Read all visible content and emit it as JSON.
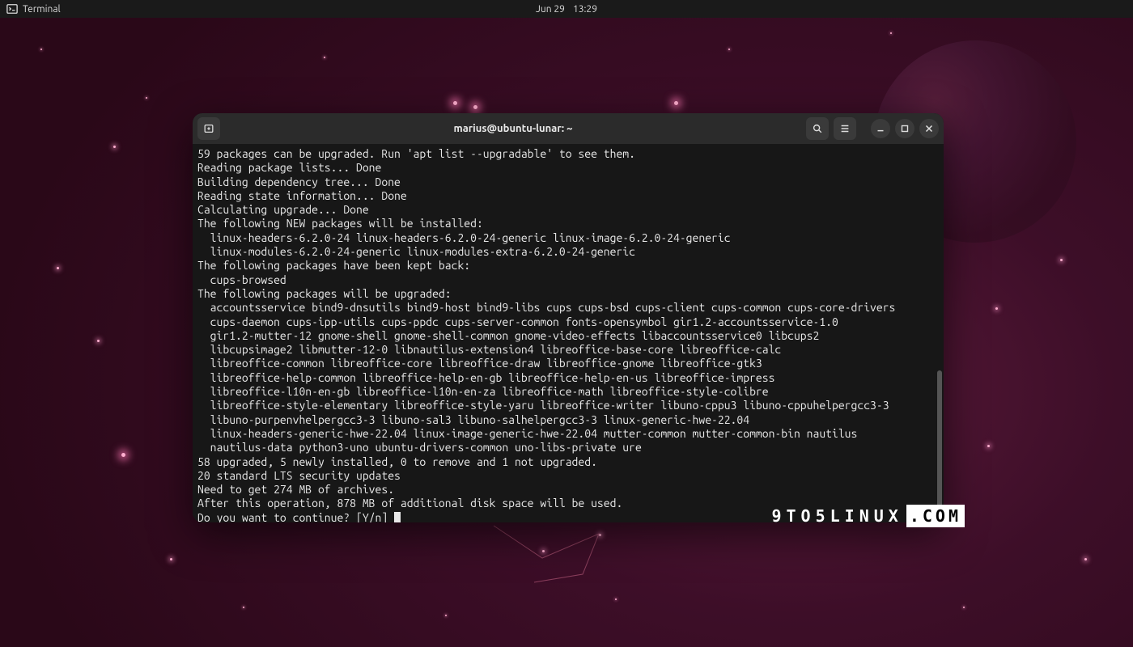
{
  "topbar": {
    "app_label": "Terminal",
    "date": "Jun 29",
    "time": "13:29"
  },
  "window": {
    "title": "marius@ubuntu-lunar: ~"
  },
  "terminal": {
    "lines": [
      "59 packages can be upgraded. Run 'apt list --upgradable' to see them.",
      "Reading package lists... Done",
      "Building dependency tree... Done",
      "Reading state information... Done",
      "Calculating upgrade... Done",
      "The following NEW packages will be installed:",
      "  linux-headers-6.2.0-24 linux-headers-6.2.0-24-generic linux-image-6.2.0-24-generic",
      "  linux-modules-6.2.0-24-generic linux-modules-extra-6.2.0-24-generic",
      "The following packages have been kept back:",
      "  cups-browsed",
      "The following packages will be upgraded:",
      "  accountsservice bind9-dnsutils bind9-host bind9-libs cups cups-bsd cups-client cups-common cups-core-drivers",
      "  cups-daemon cups-ipp-utils cups-ppdc cups-server-common fonts-opensymbol gir1.2-accountsservice-1.0",
      "  gir1.2-mutter-12 gnome-shell gnome-shell-common gnome-video-effects libaccountsservice0 libcups2",
      "  libcupsimage2 libmutter-12-0 libnautilus-extension4 libreoffice-base-core libreoffice-calc",
      "  libreoffice-common libreoffice-core libreoffice-draw libreoffice-gnome libreoffice-gtk3",
      "  libreoffice-help-common libreoffice-help-en-gb libreoffice-help-en-us libreoffice-impress",
      "  libreoffice-l10n-en-gb libreoffice-l10n-en-za libreoffice-math libreoffice-style-colibre",
      "  libreoffice-style-elementary libreoffice-style-yaru libreoffice-writer libuno-cppu3 libuno-cppuhelpergcc3-3",
      "  libuno-purpenvhelpergcc3-3 libuno-sal3 libuno-salhelpergcc3-3 linux-generic-hwe-22.04",
      "  linux-headers-generic-hwe-22.04 linux-image-generic-hwe-22.04 mutter-common mutter-common-bin nautilus",
      "  nautilus-data python3-uno ubuntu-drivers-common uno-libs-private ure",
      "58 upgraded, 5 newly installed, 0 to remove and 1 not upgraded.",
      "20 standard LTS security updates",
      "Need to get 274 MB of archives.",
      "After this operation, 878 MB of additional disk space will be used."
    ],
    "prompt_line": "Do you want to continue? [Y/n] "
  },
  "watermark": {
    "left": "9TO5LINUX",
    "right": ".COM"
  }
}
